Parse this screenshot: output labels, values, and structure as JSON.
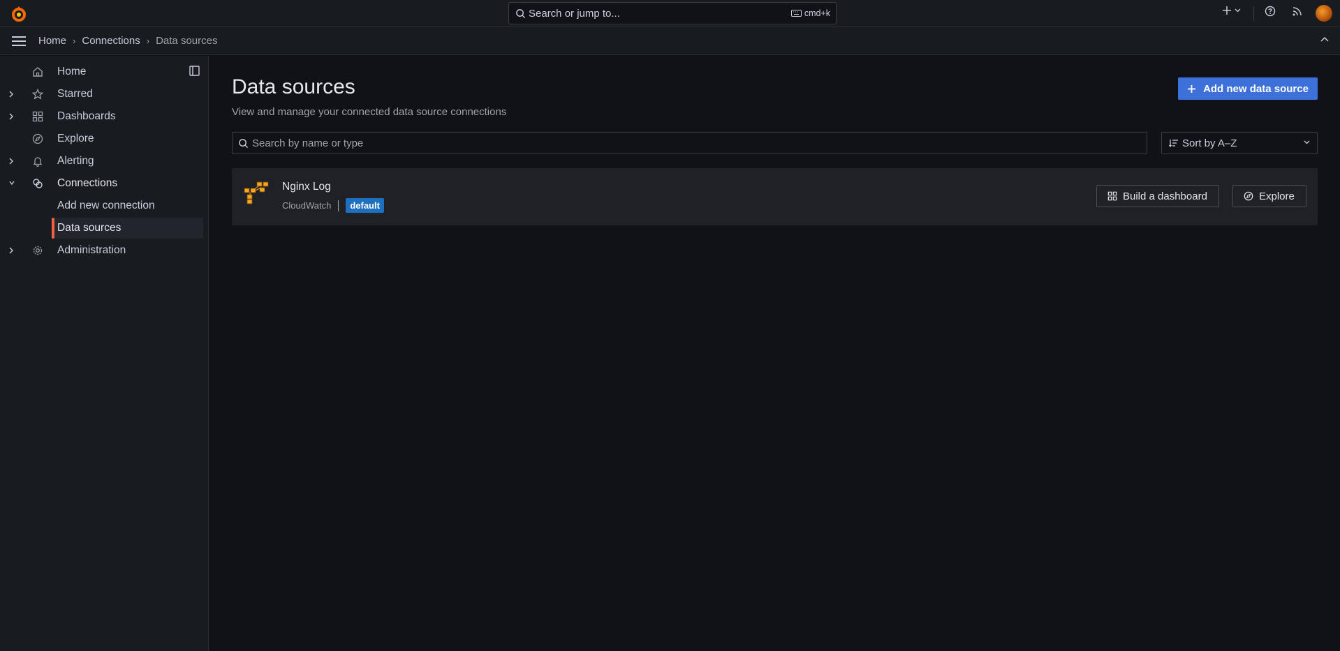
{
  "topbar": {
    "search_placeholder": "Search or jump to...",
    "shortcut": "cmd+k"
  },
  "breadcrumb": {
    "items": [
      "Home",
      "Connections",
      "Data sources"
    ]
  },
  "sidebar": {
    "items": [
      {
        "label": "Home",
        "icon": "home-icon"
      },
      {
        "label": "Starred",
        "icon": "star-icon"
      },
      {
        "label": "Dashboards",
        "icon": "apps-icon"
      },
      {
        "label": "Explore",
        "icon": "compass-icon"
      },
      {
        "label": "Alerting",
        "icon": "bell-icon"
      },
      {
        "label": "Connections",
        "icon": "connections-icon"
      },
      {
        "label": "Add new connection"
      },
      {
        "label": "Data sources"
      },
      {
        "label": "Administration",
        "icon": "cog-icon"
      }
    ]
  },
  "page": {
    "title": "Data sources",
    "subtitle": "View and manage your connected data source connections",
    "add_button": "Add new data source",
    "filter_placeholder": "Search by name or type",
    "sort_value": "Sort by A–Z"
  },
  "datasources": [
    {
      "name": "Nginx Log",
      "type": "CloudWatch",
      "badge": "default",
      "actions": [
        "Build a dashboard",
        "Explore"
      ]
    }
  ],
  "colors": {
    "accent_primary": "#3d71d9",
    "active_indicator": "#f55f3e",
    "badge": "#1f6fbf"
  }
}
